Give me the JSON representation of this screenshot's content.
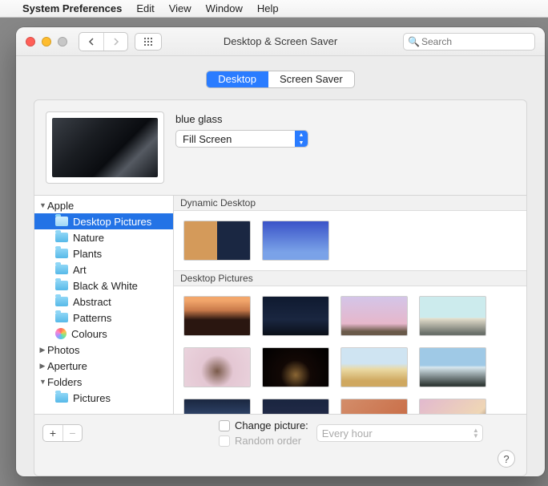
{
  "menubar": {
    "apple": "",
    "app": "System Preferences",
    "items": [
      "Edit",
      "View",
      "Window",
      "Help"
    ]
  },
  "window": {
    "title": "Desktop & Screen Saver",
    "search_placeholder": "Search",
    "tabs": {
      "desktop": "Desktop",
      "screensaver": "Screen Saver"
    },
    "wallpaper_name": "blue glass",
    "fit_mode": "Fill Screen",
    "sidebar": [
      {
        "lvl": 1,
        "tri": "down",
        "label": "Apple"
      },
      {
        "lvl": 2,
        "icon": "folder",
        "label": "Desktop Pictures",
        "sel": true
      },
      {
        "lvl": 2,
        "icon": "folder",
        "label": "Nature"
      },
      {
        "lvl": 2,
        "icon": "folder",
        "label": "Plants"
      },
      {
        "lvl": 2,
        "icon": "folder",
        "label": "Art"
      },
      {
        "lvl": 2,
        "icon": "folder",
        "label": "Black & White"
      },
      {
        "lvl": 2,
        "icon": "folder",
        "label": "Abstract"
      },
      {
        "lvl": 2,
        "icon": "folder",
        "label": "Patterns"
      },
      {
        "lvl": 2,
        "icon": "colors",
        "label": "Colours"
      },
      {
        "lvl": 1,
        "tri": "right",
        "label": "Photos"
      },
      {
        "lvl": 1,
        "tri": "right",
        "label": "Aperture"
      },
      {
        "lvl": 1,
        "tri": "down",
        "label": "Folders"
      },
      {
        "lvl": 2,
        "icon": "folder",
        "label": "Pictures"
      }
    ],
    "sections": {
      "dynamic": "Dynamic Desktop",
      "pictures": "Desktop Pictures"
    },
    "bottom": {
      "change_label": "Change picture:",
      "random_label": "Random order",
      "interval": "Every hour",
      "plus": "+",
      "minus": "−",
      "help": "?"
    }
  }
}
